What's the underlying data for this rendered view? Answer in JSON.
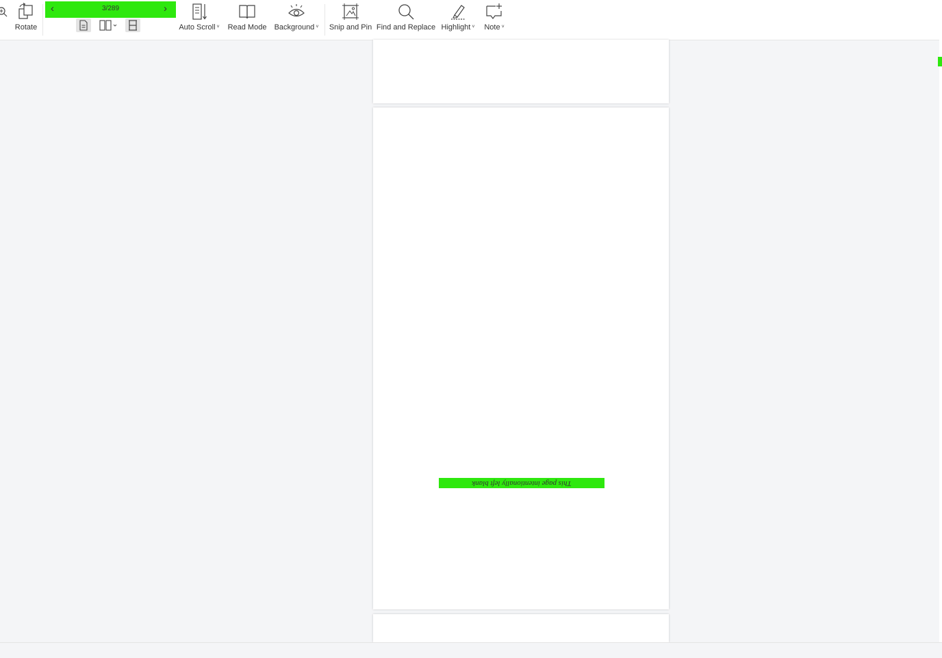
{
  "toolbar": {
    "rotate_label": "Rotate",
    "page_indicator": "3/289",
    "auto_scroll_label": "Auto Scroll",
    "read_mode_label": "Read Mode",
    "background_label": "Background",
    "snip_pin_label": "Snip and Pin",
    "find_replace_label": "Find and Replace",
    "highlight_label": "Highlight",
    "note_label": "Note",
    "dropdown_caret": "˅"
  },
  "document": {
    "blank_page_note": "This page intentionally left blank"
  },
  "colors": {
    "highlight": "#2ee80e",
    "canvas": "#f4f5f7"
  }
}
